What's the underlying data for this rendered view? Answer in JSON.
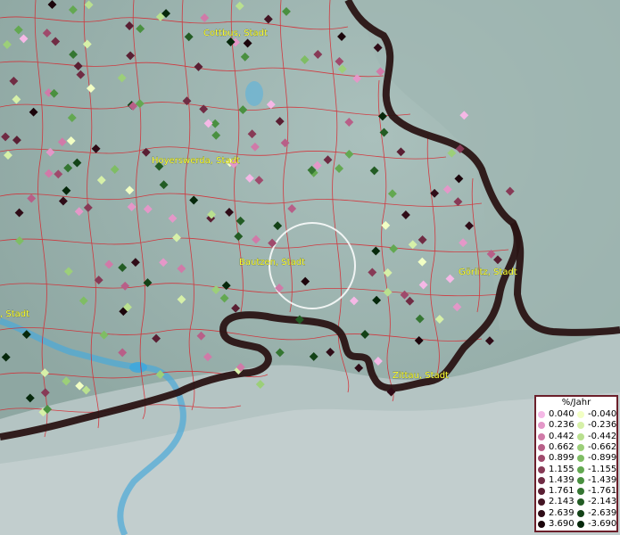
{
  "map": {
    "cities": [
      {
        "label": "Cottbus, Stadt"
      },
      {
        "label": "Hoyerswerda, Stadt"
      },
      {
        "label": "Bautzen, Stadt"
      },
      {
        "label": "Görlitz, Stadt"
      },
      {
        "label": "Zittau, Stadt"
      },
      {
        "label": ", Stadt"
      }
    ]
  },
  "legend": {
    "title": "%/Jahr",
    "positive": [
      {
        "value": "0.040",
        "color": "#f5b8e6"
      },
      {
        "value": "0.236",
        "color": "#e497c8"
      },
      {
        "value": "0.442",
        "color": "#d07aa8"
      },
      {
        "value": "0.662",
        "color": "#b85f88"
      },
      {
        "value": "0.899",
        "color": "#9f4a6c"
      },
      {
        "value": "1.155",
        "color": "#873a56"
      },
      {
        "value": "1.439",
        "color": "#702c44"
      },
      {
        "value": "1.761",
        "color": "#5a1f33"
      },
      {
        "value": "2.143",
        "color": "#441524"
      },
      {
        "value": "2.639",
        "color": "#2f0c17"
      },
      {
        "value": "3.690",
        "color": "#1c050b"
      }
    ],
    "negative": [
      {
        "value": "-0.040",
        "color": "#f2ffc4"
      },
      {
        "value": "-0.236",
        "color": "#d6f0a8"
      },
      {
        "value": "-0.442",
        "color": "#b9e08f"
      },
      {
        "value": "-0.662",
        "color": "#9ccf79"
      },
      {
        "value": "-0.899",
        "color": "#7fbd64"
      },
      {
        "value": "-1.155",
        "color": "#63a851"
      },
      {
        "value": "-1.439",
        "color": "#4a9040"
      },
      {
        "value": "-1.761",
        "color": "#357632"
      },
      {
        "value": "-2.143",
        "color": "#235c24"
      },
      {
        "value": "-2.639",
        "color": "#134217"
      },
      {
        "value": "-3.690",
        "color": "#06280b"
      }
    ]
  }
}
